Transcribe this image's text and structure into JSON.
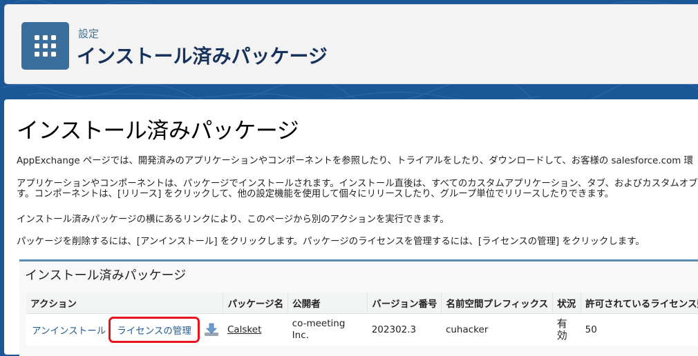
{
  "header": {
    "breadcrumb": "設定",
    "title": "インストール済みパッケージ",
    "icon": "app-grid-icon"
  },
  "main": {
    "title": "インストール済みパッケージ",
    "paragraphs": [
      "AppExchange ページでは、開発済みのアプリケーションやコンポーネントを参照したり、トライアルをしたり、ダウンロードして、お客様の salesforce.com 環",
      "アプリケーションやコンポーネントは、パッケージでインストールされます。インストール直後は、すべてのカスタムアプリケーション、タブ、およびカスタムオブジェク",
      "す。コンポーネントは、[リリース] をクリックして、他の設定機能を使用して個々にリリースしたり、グループ単位でリリースしたりできます。",
      "インストール済みパッケージの横にあるリンクにより、このページから別のアクションを実行できます。",
      "パッケージを削除するには、[アンインストール] をクリックします。パッケージのライセンスを管理するには、[ライセンスの管理] をクリックします。"
    ]
  },
  "panel": {
    "title": "インストール済みパッケージ",
    "columns": [
      "アクション",
      "パッケージ名",
      "公開者",
      "バージョン番号",
      "名前空間プレフィックス",
      "状況",
      "許可されているライセンス数"
    ],
    "row": {
      "uninstall": "アンインストール",
      "manage_license": "ライセンスの管理",
      "download_icon": "download-icon",
      "package_name": "Calsket",
      "publisher_line1": "co-meeting",
      "publisher_line2": "Inc.",
      "version": "202302.3",
      "namespace": "cuhacker",
      "status_line1": "有",
      "status_line2": "効",
      "licenses": "50"
    }
  },
  "colors": {
    "background": "#1b5797",
    "icon_bg": "#3a6e9c",
    "highlight": "#e8121a",
    "link": "#1f5d99"
  }
}
